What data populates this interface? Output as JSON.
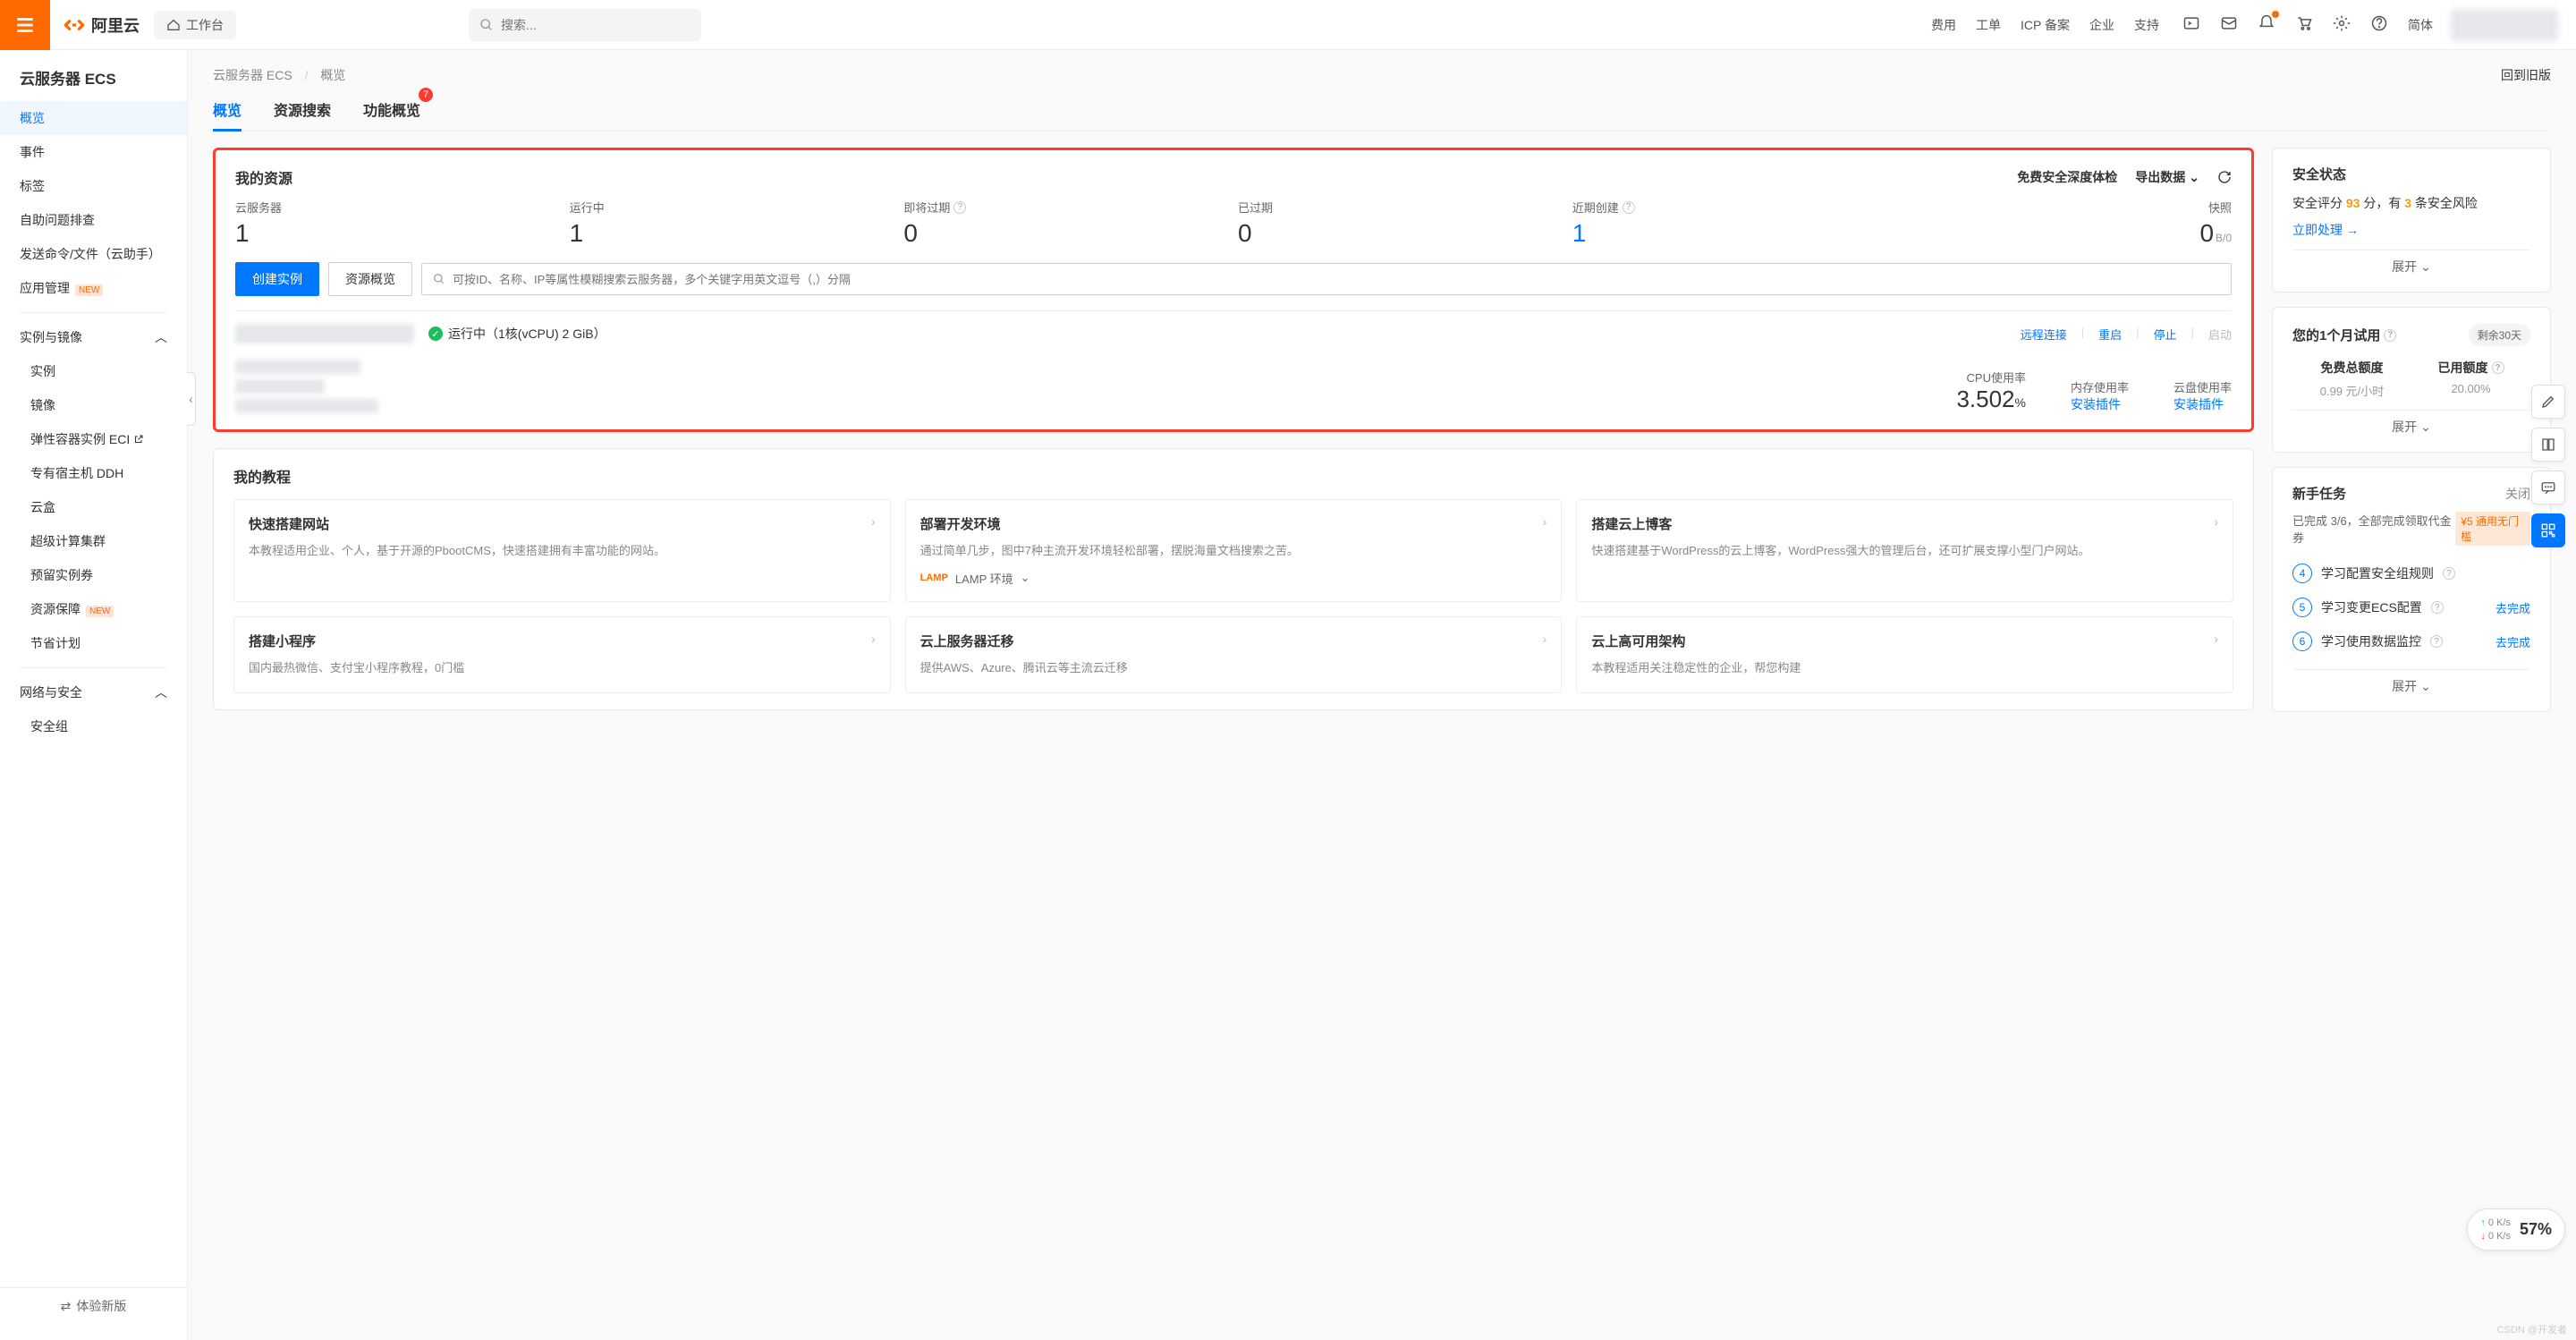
{
  "header": {
    "brand": "阿里云",
    "workspace": "工作台",
    "search_placeholder": "搜索...",
    "links": [
      "费用",
      "工单",
      "ICP 备案",
      "企业",
      "支持"
    ],
    "language": "简体"
  },
  "sidebar": {
    "title": "云服务器 ECS",
    "items": [
      {
        "label": "概览",
        "active": true
      },
      {
        "label": "事件"
      },
      {
        "label": "标签"
      },
      {
        "label": "自助问题排查"
      },
      {
        "label": "发送命令/文件（云助手）"
      },
      {
        "label": "应用管理",
        "new": true
      }
    ],
    "group1": {
      "label": "实例与镜像",
      "items": [
        {
          "label": "实例"
        },
        {
          "label": "镜像"
        },
        {
          "label": "弹性容器实例 ECI",
          "ext": true
        },
        {
          "label": "专有宿主机 DDH"
        },
        {
          "label": "云盒"
        },
        {
          "label": "超级计算集群"
        },
        {
          "label": "预留实例券"
        },
        {
          "label": "资源保障",
          "new": true
        },
        {
          "label": "节省计划"
        }
      ]
    },
    "group2": {
      "label": "网络与安全",
      "items": [
        {
          "label": "安全组"
        }
      ]
    },
    "footer": "体验新版"
  },
  "breadcrumb": {
    "a": "云服务器 ECS",
    "b": "概览",
    "old": "回到旧版"
  },
  "tabs": [
    {
      "label": "概览",
      "active": true
    },
    {
      "label": "资源搜索"
    },
    {
      "label": "功能概览",
      "badge": "7"
    }
  ],
  "resources": {
    "title": "我的资源",
    "free_check": "免费安全深度体检",
    "export": "导出数据",
    "stats": [
      {
        "label": "云服务器",
        "value": "1"
      },
      {
        "label": "运行中",
        "value": "1"
      },
      {
        "label": "即将过期",
        "value": "0",
        "help": true
      },
      {
        "label": "已过期",
        "value": "0"
      },
      {
        "label": "近期创建",
        "value": "1",
        "help": true,
        "link": true
      },
      {
        "label": "快照",
        "value": "0",
        "unit": "B/0"
      }
    ],
    "create_btn": "创建实例",
    "overview_btn": "资源概览",
    "search_placeholder": "可按ID、名称、IP等属性模糊搜索云服务器，多个关键字用英文逗号（,）分隔",
    "instance": {
      "status": "运行中（1核(vCPU) 2 GiB）",
      "actions": {
        "remote": "远程连接",
        "restart": "重启",
        "stop": "停止",
        "start": "启动"
      },
      "usage": [
        {
          "label": "CPU使用率",
          "value": "3.502",
          "pct": "%"
        },
        {
          "label": "内存使用率",
          "link": "安装插件"
        },
        {
          "label": "云盘使用率",
          "link": "安装插件"
        }
      ]
    }
  },
  "tutorials": {
    "title": "我的教程",
    "row1": [
      {
        "title": "快速搭建网站",
        "desc": "本教程适用企业、个人，基于开源的PbootCMS，快速搭建拥有丰富功能的网站。"
      },
      {
        "title": "部署开发环境",
        "desc": "通过简单几步，图中7种主流开发环境轻松部署，摆脱海量文档搜索之苦。",
        "lamp": "LAMP 环境"
      },
      {
        "title": "搭建云上博客",
        "desc": "快速搭建基于WordPress的云上博客，WordPress强大的管理后台，还可扩展支撑小型门户网站。"
      }
    ],
    "row2": [
      {
        "title": "搭建小程序",
        "desc": "国内最热微信、支付宝小程序教程，0门槛"
      },
      {
        "title": "云上服务器迁移",
        "desc": "提供AWS、Azure、腾讯云等主流云迁移"
      },
      {
        "title": "云上高可用架构",
        "desc": "本教程适用关注稳定性的企业，帮您构建"
      }
    ]
  },
  "security": {
    "title": "安全状态",
    "line_a": "安全评分 ",
    "score": "93",
    "line_b": " 分，有 ",
    "risks": "3",
    "line_c": " 条安全风险",
    "action": "立即处理",
    "expand": "展开"
  },
  "trial": {
    "title": "您的1个月试用",
    "remain": "剩余30天",
    "free_label": "免费总额度",
    "free_val": "0.99 元/小时",
    "used_label": "已用额度",
    "used_val": "20.00%",
    "expand": "展开"
  },
  "tasks": {
    "title": "新手任务",
    "close": "关闭",
    "progress": "已完成 3/6，全部完成领取代金券",
    "coupon": "¥5 通用无门槛",
    "items": [
      {
        "n": "4",
        "label": "学习配置安全组规则"
      },
      {
        "n": "5",
        "label": "学习变更ECS配置",
        "action": "去完成"
      },
      {
        "n": "6",
        "label": "学习使用数据监控",
        "action": "去完成"
      }
    ],
    "expand": "展开"
  },
  "speed": {
    "up": "0  K/s",
    "down": "0  K/s",
    "pct": "57%"
  },
  "watermark": "CSDN @开发者"
}
